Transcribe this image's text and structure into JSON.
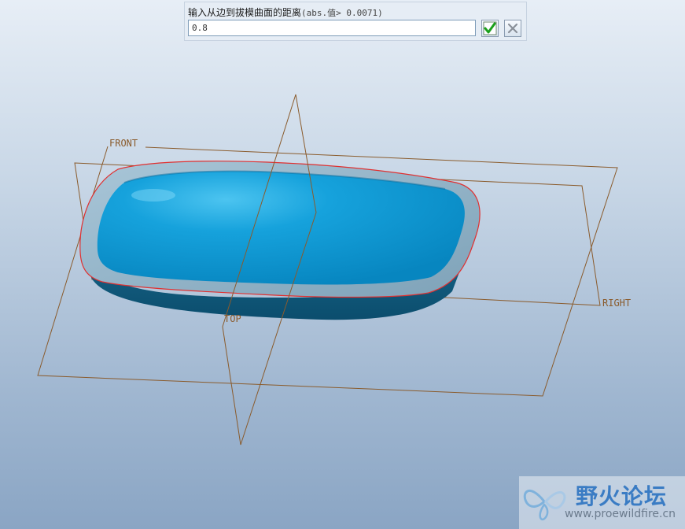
{
  "prompt": {
    "label": "输入从边到拔模曲面的距离",
    "hint": "(abs.值> 0.0071)",
    "value": "0.8"
  },
  "buttons": {
    "ok_icon": "checkmark-icon",
    "cancel_icon": "close-icon"
  },
  "datum_planes": {
    "front": "FRONT",
    "top": "TOP",
    "right": "RIGHT"
  },
  "watermark": {
    "title": "野火论坛",
    "url": "www.proewildfire.cn"
  },
  "colors": {
    "part_blue": "#0a9ad6",
    "part_rim": "#8fb3c9",
    "datum_brown": "#8a5b2c",
    "edge_red": "#e03030",
    "ok_green": "#1aa01a"
  }
}
